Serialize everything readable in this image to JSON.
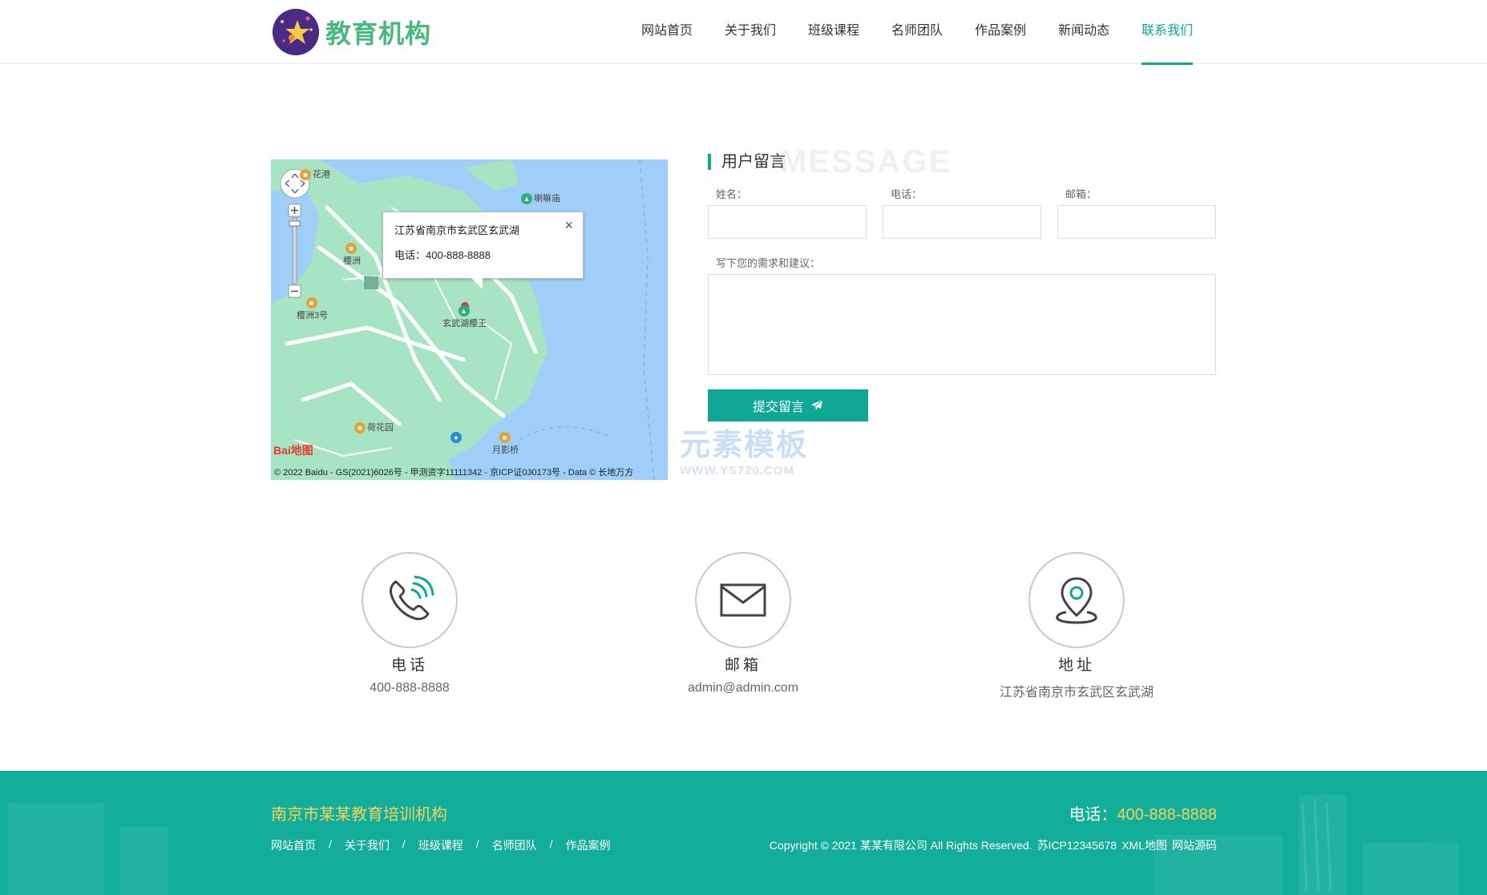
{
  "header": {
    "logo_text": "教育机构",
    "nav": [
      {
        "label": "网站首页",
        "active": false
      },
      {
        "label": "关于我们",
        "active": false
      },
      {
        "label": "班级课程",
        "active": false
      },
      {
        "label": "名师团队",
        "active": false
      },
      {
        "label": "作品案例",
        "active": false
      },
      {
        "label": "新闻动态",
        "active": false
      },
      {
        "label": "联系我们",
        "active": true
      }
    ]
  },
  "map": {
    "popup_address": "江苏省南京市玄武区玄武湖",
    "popup_phone": "电话：400-888-8888",
    "close_glyph": "×",
    "pois": [
      "花港",
      "喇嘛庙",
      "樱洲",
      "樱洲3号",
      "玄武湖樱王",
      "荷花园",
      "月影桥"
    ],
    "baidu_logo": "Bai地图",
    "copyright": "© 2022 Baidu - GS(2021)6026号 - 甲测资字11111342 - 京ICP证030173号 - Data © 长地万方"
  },
  "form": {
    "title": "用户留言",
    "title_bg": "MESSAGE",
    "name_label": "姓名：",
    "phone_label": "电话：",
    "email_label": "邮箱：",
    "name_value": "",
    "phone_value": "",
    "email_value": "",
    "message_label": "写下您的需求和建议：",
    "message_value": "",
    "submit_label": "提交留言"
  },
  "watermark": {
    "cn": "元素模板",
    "en": "WWW.YS720.COM"
  },
  "contacts": [
    {
      "title": "电话",
      "value": "400-888-8888",
      "icon": "phone-icon"
    },
    {
      "title": "邮箱",
      "value": "admin@admin.com",
      "icon": "mail-icon"
    },
    {
      "title": "地址",
      "value": "江苏省南京市玄武区玄武湖",
      "icon": "location-icon"
    }
  ],
  "footer": {
    "company": "南京市某某教育培训机构",
    "phone_label": "电话：",
    "phone_number": "400-888-8888",
    "links": [
      "网站首页",
      "关于我们",
      "班级课程",
      "名师团队",
      "作品案例"
    ],
    "separator": "/",
    "copyright": "Copyright © 2021 某某有限公司 All Rights Reserved.",
    "icp": "苏ICP12345678",
    "xml_map": "XML地图",
    "source": "网站源码"
  },
  "colors": {
    "accent": "#10a894",
    "footer_bg": "#12ae9a",
    "footer_highlight": "#f3d35d",
    "logo_green": "#46b97c"
  }
}
